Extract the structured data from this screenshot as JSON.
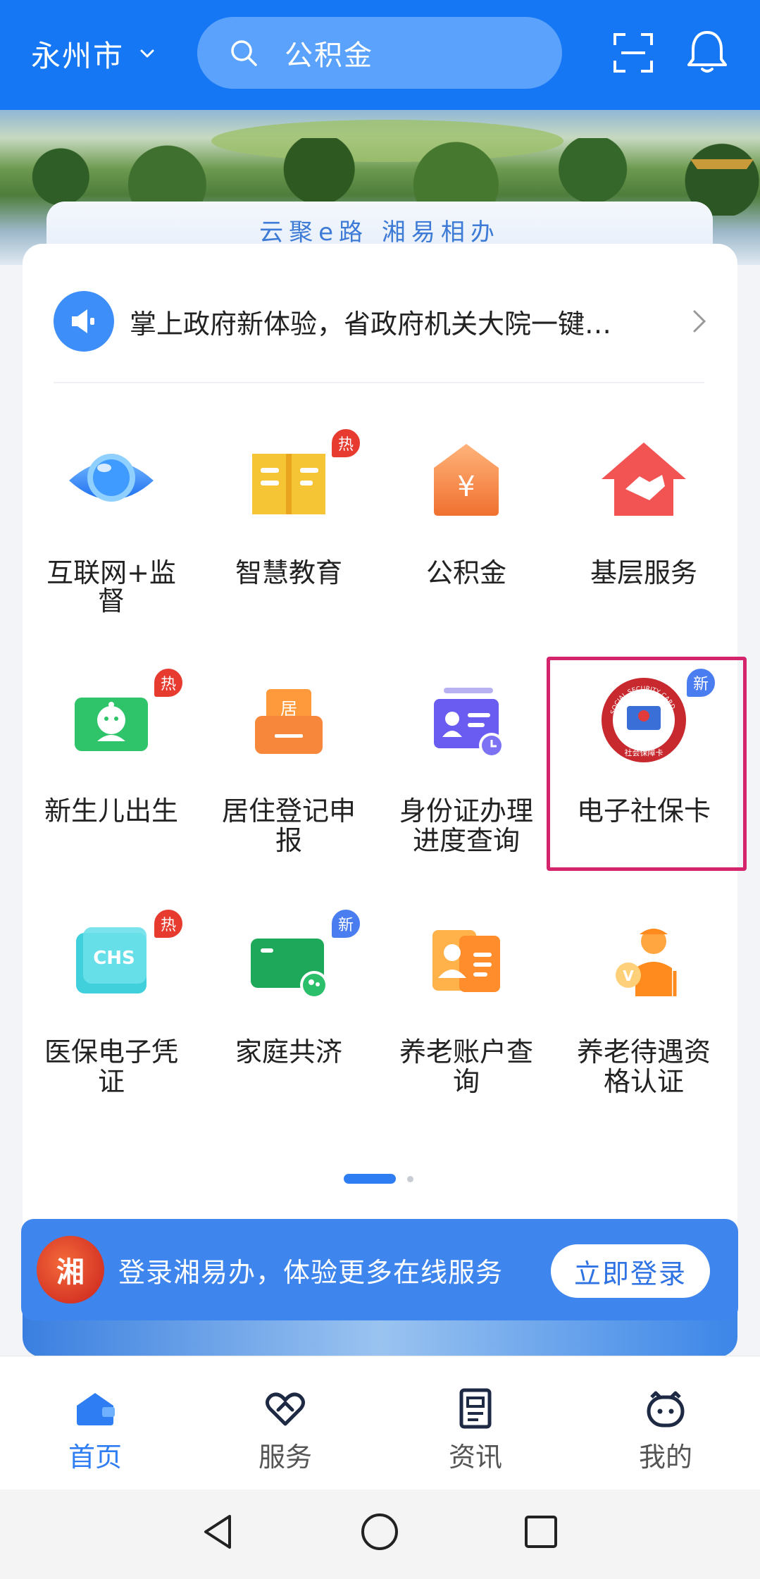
{
  "header": {
    "city": "永州市",
    "search_placeholder": "公积金"
  },
  "banner": {
    "slogan": "云聚e路 湘易相办"
  },
  "notice": {
    "text": "掌上政府新体验，省政府机关大院一键…"
  },
  "services": [
    {
      "label_line1": "互联网+监",
      "label_line2": "督",
      "badge": ""
    },
    {
      "label_line1": "智慧教育",
      "label_line2": "",
      "badge": "热"
    },
    {
      "label_line1": "公积金",
      "label_line2": "",
      "badge": ""
    },
    {
      "label_line1": "基层服务",
      "label_line2": "",
      "badge": ""
    },
    {
      "label_line1": "新生儿出生",
      "label_line2": "",
      "badge": "热"
    },
    {
      "label_line1": "居住登记申",
      "label_line2": "报",
      "badge": ""
    },
    {
      "label_line1": "身份证办理",
      "label_line2": "进度查询",
      "badge": ""
    },
    {
      "label_line1": "电子社保卡",
      "label_line2": "",
      "badge": "新"
    },
    {
      "label_line1": "医保电子凭",
      "label_line2": "证",
      "badge": "热"
    },
    {
      "label_line1": "家庭共济",
      "label_line2": "",
      "badge": "新"
    },
    {
      "label_line1": "养老账户查",
      "label_line2": "询",
      "badge": ""
    },
    {
      "label_line1": "养老待遇资",
      "label_line2": "格认证",
      "badge": ""
    }
  ],
  "icons": {
    "residence_tag": "居",
    "fund_symbol": "¥",
    "medical_card_text": "CHS",
    "pension_symbol": "V",
    "social_card_ring": "SOCIAL SECURITY CARD",
    "social_card_bottom": "社会保障卡"
  },
  "login_bar": {
    "logo_text": "湘",
    "text": "登录湘易办，体验更多在线服务",
    "button": "立即登录"
  },
  "tabs": [
    {
      "label": "首页",
      "active": true
    },
    {
      "label": "服务",
      "active": false
    },
    {
      "label": "资讯",
      "active": false
    },
    {
      "label": "我的",
      "active": false
    }
  ],
  "colors": {
    "primary": "#1677f5",
    "highlight_border": "#d4246b",
    "hot_badge": "#e63b2e",
    "new_badge": "#4a7ef0"
  }
}
